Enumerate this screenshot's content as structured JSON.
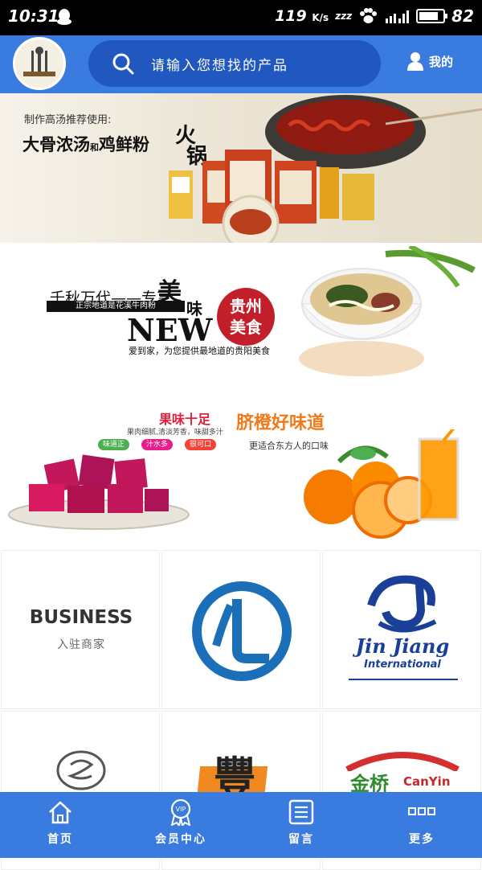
{
  "status_bar": {
    "time": "10:31",
    "net_speed": "119",
    "net_unit": "K/s",
    "sleep": "zzz",
    "battery": "82",
    "battery_level": 0.82
  },
  "header": {
    "search_placeholder": "请输入您想找的产品",
    "mine_label": "我的"
  },
  "banner_soup": {
    "subtitle": "制作高汤推荐使用:",
    "title_a": "大骨浓汤",
    "title_and": "和",
    "title_b": "鸡鲜粉",
    "hotpot_char1": "火",
    "hotpot_char2": "锅"
  },
  "banner_guizhou": {
    "slogan": "千秋万代——专享",
    "mei": "美",
    "wei": "味",
    "black_bar": "正宗地道是花溪牛肉粉",
    "new": "NEW",
    "badge_line1": "贵州",
    "badge_line2": "美食",
    "desc": "爱到家，为您提供最地道的贵阳美食"
  },
  "banner_fruit": {
    "title": "果味十足",
    "sub": "果肉细腻,清淡芳香，味甜多汁",
    "pills": [
      "味道正",
      "汁水多",
      "很可口"
    ],
    "pill_colors": [
      "#4caf50",
      "#e91e8c",
      "#f44336"
    ]
  },
  "banner_orange": {
    "title": "脐橙好味道",
    "sub": "更适合东方人的口味"
  },
  "grid": {
    "business_title": "BUSINESS",
    "business_sub": "入驻商家",
    "jinjiang_line1": "Jin Jiang",
    "jinjiang_line2": "International",
    "feng_char": "豐",
    "jinqiao_cn": "金桥",
    "jinqiao_en": "CanYin"
  },
  "bottom_nav": {
    "items": [
      {
        "label": "首页",
        "icon": "home-icon"
      },
      {
        "label": "会员中心",
        "icon": "vip-icon"
      },
      {
        "label": "留言",
        "icon": "message-icon"
      },
      {
        "label": "更多",
        "icon": "more-icon"
      }
    ],
    "vip_badge": "VIP"
  },
  "colors": {
    "header_blue": "#3a7be0",
    "search_blue": "#2158c0"
  }
}
